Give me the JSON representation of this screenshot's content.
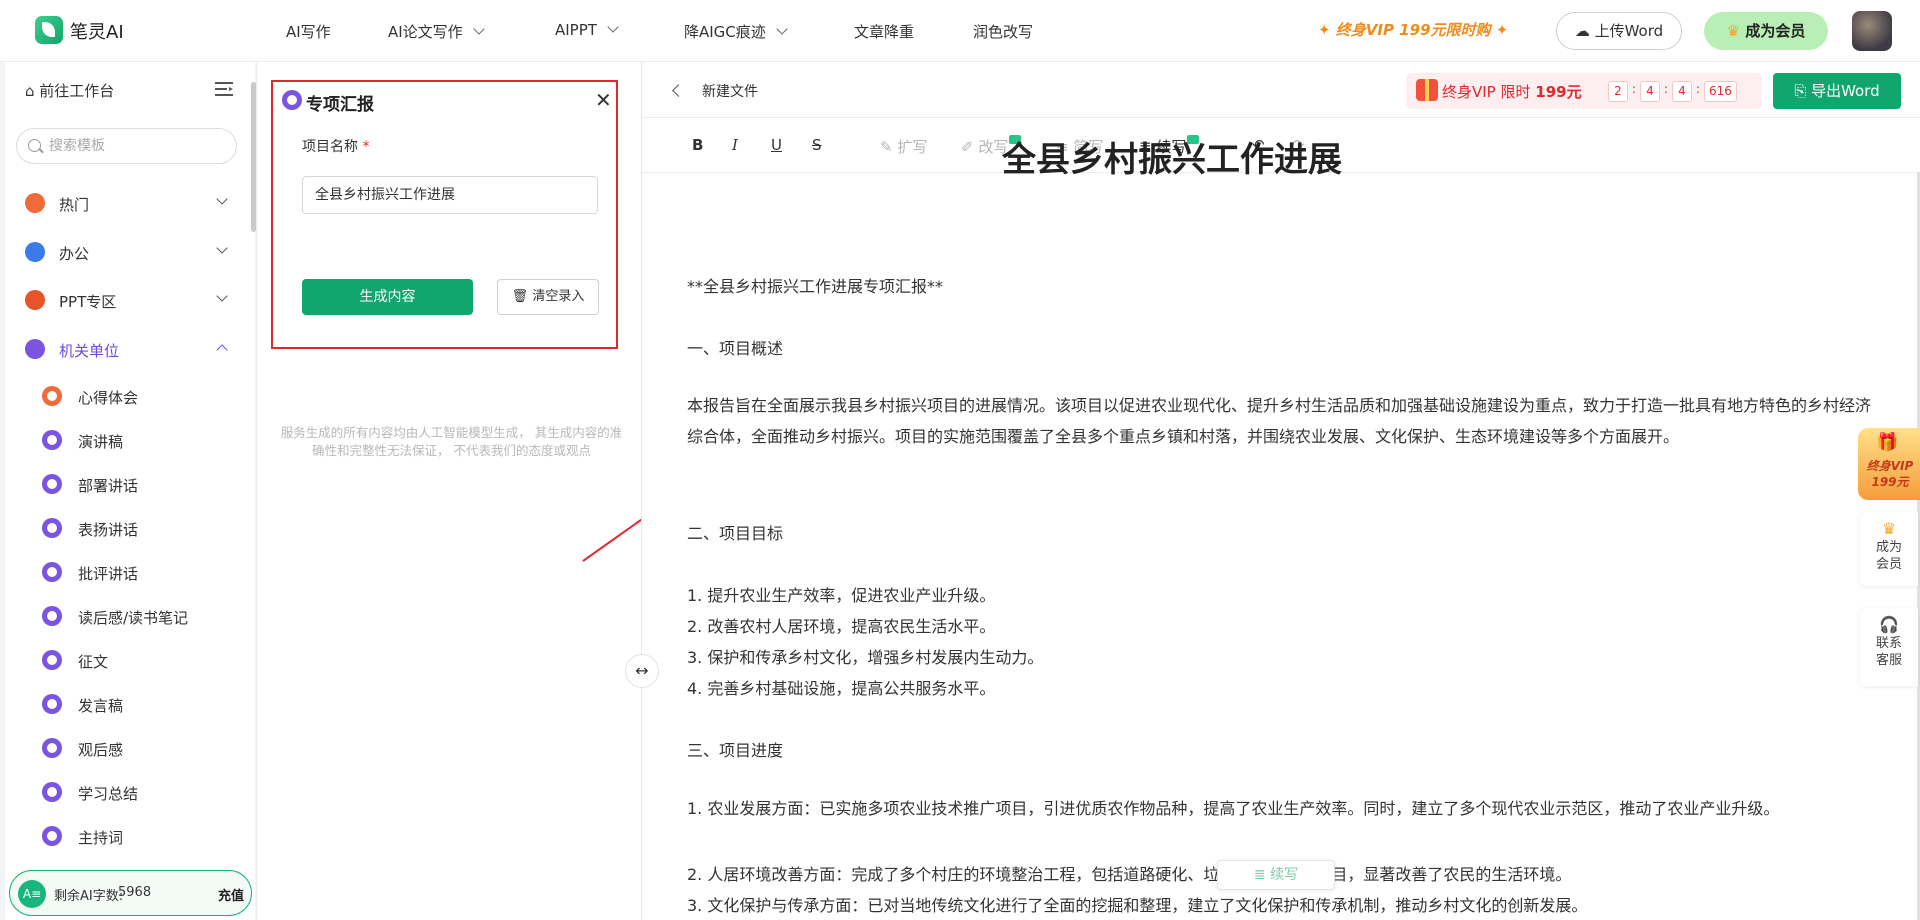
{
  "app": {
    "name": "笔灵AI"
  },
  "nav": {
    "items": [
      "AI写作",
      "AI论文写作",
      "AIPPT",
      "降AIGC痕迹",
      "文章降重",
      "润色改写"
    ],
    "promo": "终身VIP 199元限时购",
    "upload_label": "上传Word",
    "member_label": "成为会员"
  },
  "sidebar": {
    "home_label": "前往工作台",
    "search_placeholder": "搜索模板",
    "categories": [
      {
        "label": "热门",
        "icon": "fire-icon"
      },
      {
        "label": "办公",
        "icon": "briefcase-icon"
      },
      {
        "label": "PPT专区",
        "icon": "ppt-icon"
      },
      {
        "label": "机关单位",
        "icon": "badge-icon"
      }
    ],
    "sub_items": [
      "心得体会",
      "演讲稿",
      "部署讲话",
      "表扬讲话",
      "批评讲话",
      "读后感/读书笔记",
      "征文",
      "发言稿",
      "观后感",
      "学习总结",
      "主持词"
    ],
    "quota_label": "剩余AI字数:",
    "quota_value": "5968",
    "recharge_label": "充值"
  },
  "form": {
    "title": "专项汇报",
    "field_label": "项目名称",
    "required_mark": "*",
    "field_value": "全县乡村振兴工作进展",
    "generate_label": "生成内容",
    "clear_label": "清空录入",
    "disclaimer": "服务生成的所有内容均由人工智能模型生成， 其生成内容的准确性和完整性无法保证， 不代表我们的态度或观点"
  },
  "editor": {
    "doc_name": "新建文件",
    "promo_text": "终身VIP 限时",
    "promo_price": "199元",
    "countdown": [
      "2",
      "4",
      "4",
      "616"
    ],
    "export_label": "导出Word",
    "toolbar": {
      "bold": "B",
      "italic": "I",
      "underline": "U",
      "strike": "S",
      "expand": "扩写",
      "rewrite": "改写",
      "simplify": "简写",
      "continue": "续写",
      "undo": "↶",
      "redo": "↷"
    },
    "title": "全县乡村振兴工作进展",
    "paragraphs": [
      "**全县乡村振兴工作进展专项汇报**",
      "一、项目概述",
      "本报告旨在全面展示我县乡村振兴项目的进展情况。该项目以促进农业现代化、提升乡村生活品质和加强基础设施建设为重点，致力于打造一批具有地方特色的乡村经济综合体，全面推动乡村振兴。项目的实施范围覆盖了全县多个重点乡镇和村落，并围绕农业发展、文化保护、生态环境建设等多个方面展开。",
      "二、项目目标",
      "1. 提升农业生产效率，促进农业产业升级。",
      "2. 改善农村人居环境，提高农民生活水平。",
      "3. 保护和传承乡村文化，增强乡村发展内生动力。",
      "4. 完善乡村基础设施，提高公共服务水平。",
      "三、项目进度",
      "1. 农业发展方面：已实施多项农业技术推广项目，引进优质农作物品种，提高了农业生产效率。同时，建立了多个现代农业示范区，推动了农业产业升级。",
      "2. 人居环境改善方面：完成了多个村庄的环境整治工程，包括道路硬化、垃圾分类处理等项目，显著改善了农民的生活环境。",
      "3. 文化保护与传承方面：已对当地传统文化进行了全面的挖掘和整理，建立了文化保护和传承机制，推动乡村文化的创新发展。"
    ],
    "float_continue": "续写"
  },
  "right_widgets": {
    "vip_text": "终身VIP 199元",
    "member_label": "成为会员",
    "service_label": "联系客服"
  },
  "colors": {
    "brand_green": "#12a66f",
    "accent_purple": "#6c4bd8",
    "highlight_red": "#e0282e",
    "promo_orange": "#f08c1a"
  }
}
